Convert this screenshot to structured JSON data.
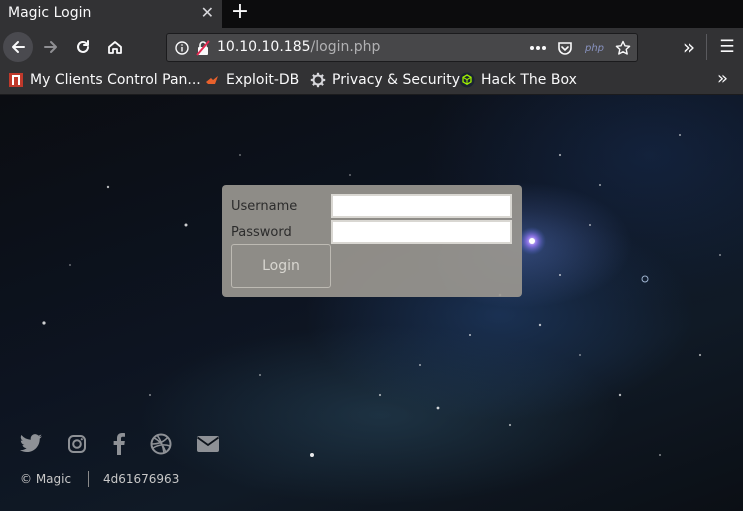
{
  "browser": {
    "tab_title": "Magic Login",
    "tab_close": "✕",
    "new_tab": "+",
    "url_host": "10.10.10.185",
    "url_path": "/login.php",
    "page_action_php": "php",
    "overflow": "»",
    "menu": "☰"
  },
  "bookmarks": [
    {
      "label": "My Clients Control Pan...",
      "icon": "red-building-icon"
    },
    {
      "label": "Exploit-DB",
      "icon": "exploit-db-icon"
    },
    {
      "label": "Privacy & Security",
      "icon": "gear-icon"
    },
    {
      "label": "Hack The Box",
      "icon": "htb-cube-icon"
    }
  ],
  "bookmarks_overflow": "»",
  "login": {
    "username_label": "Username",
    "password_label": "Password",
    "username_value": "",
    "password_value": "",
    "submit_label": "Login"
  },
  "social": [
    "twitter-icon",
    "instagram-icon",
    "facebook-icon",
    "dribbble-icon",
    "envelope-icon"
  ],
  "footer": {
    "copyright": "© Magic",
    "hex": "4d61676963"
  },
  "colors": {
    "chrome": "#323234",
    "tabbar": "#0c0c0d",
    "login_box": "#99968f",
    "social_icon": "#8e9196"
  }
}
